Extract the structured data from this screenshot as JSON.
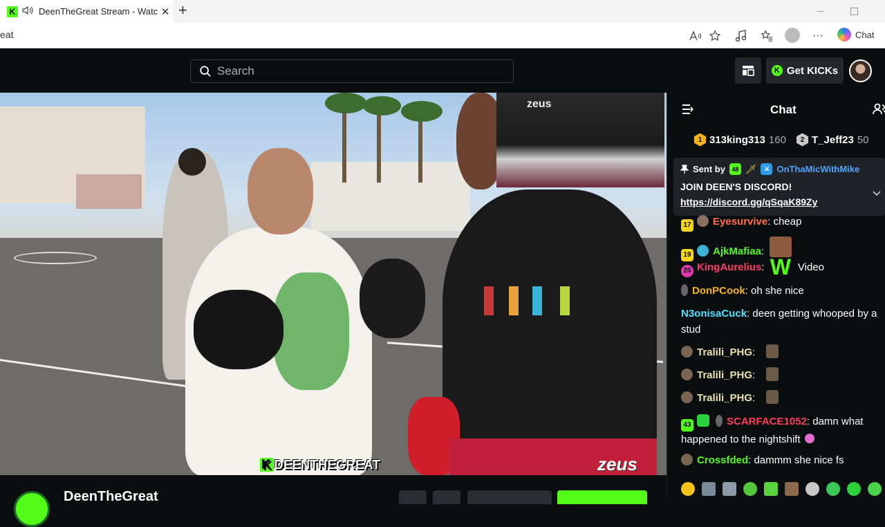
{
  "browser": {
    "tab_title": "DeenTheGreat Stream - Watch",
    "favicon_letter": "K",
    "tab_close": "✕",
    "new_tab": "+",
    "address": "eat",
    "copilot_label": "Chat",
    "more_label": "···"
  },
  "kick": {
    "search_placeholder": "Search",
    "get_kicks_label": "Get KICKs",
    "coin_letter": "K"
  },
  "video": {
    "overlay_k": "K",
    "overlay_name": "DEENTHEGREAT",
    "watermark": "zeus",
    "webcam_watermark": "zeus"
  },
  "channel": {
    "name": "DeenTheGreat"
  },
  "chat": {
    "title": "Chat",
    "leaderboard": [
      {
        "rank": "1",
        "name": "313king313",
        "count": "160",
        "color": "#f5b21b"
      },
      {
        "rank": "2",
        "name": "T_Jeff23",
        "count": "50",
        "color": "#c8c8c8"
      }
    ],
    "pinned": {
      "sent_by_label": "Sent by",
      "sub_badge": "48",
      "sender": "OnThaMicWithMike",
      "message": "JOIN DEEN'S DISCORD!",
      "link": "https://discord.gg/qSqaK89Zy"
    },
    "messages": [
      {
        "badge": "17",
        "user": "Eyesurvive",
        "text": ": cheap",
        "color": "#ff6b4a"
      },
      {
        "badge": "19",
        "user": "AjkMafiaa",
        "text": ":",
        "color": "#53fc18"
      },
      {
        "badge": "25",
        "user": "KingAurelius",
        "text": ":",
        "emote_text": "W",
        "after": "Video",
        "color": "#ff3b6b"
      },
      {
        "user": "DonPCook",
        "text": ": oh she nice",
        "color": "#f5b21b"
      },
      {
        "user": "N3onisaCuck",
        "text": ": deen getting whooped by a stud",
        "color": "#4fe0ff"
      },
      {
        "user": "Tralili_PHG",
        "text": ":",
        "color": "#e8e0b0"
      },
      {
        "user": "Tralili_PHG",
        "text": ":",
        "color": "#e8e0b0"
      },
      {
        "user": "Tralili_PHG",
        "text": ":",
        "color": "#e8e0b0"
      },
      {
        "badge": "43",
        "user": "SCARFACE1052",
        "text": ": damn what happened to the nightshift",
        "color": "#ff3b5c"
      },
      {
        "user": "Crossfded",
        "text": ": dammm she nice fs",
        "color": "#53fc18"
      }
    ]
  },
  "colors": {
    "kick_green": "#53fc18",
    "bg": "#0b0e0f",
    "panel": "#24272c"
  }
}
